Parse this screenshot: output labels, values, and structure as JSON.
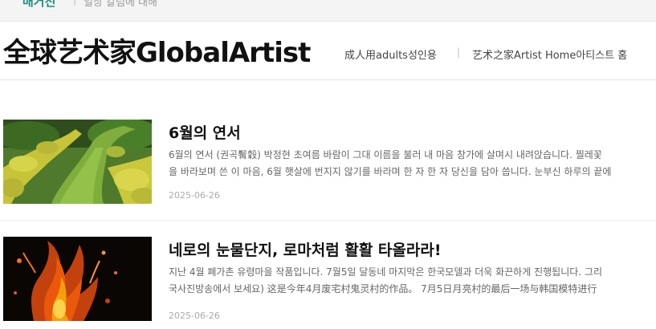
{
  "breadcrumb": {
    "section": "매거진",
    "separator": "|",
    "category": "일상 칼럼에 대해"
  },
  "header": {
    "site_title": "全球艺术家GlobalArtist",
    "nav": [
      {
        "label": "成人用adults성인용"
      },
      {
        "label": "艺术之家Artist Home아티스트 홈"
      }
    ],
    "nav_separator": "|"
  },
  "articles": [
    {
      "title": "6월의 연서",
      "excerpt_line1": "6월의 연서 (권곡鬌穀) 박정현 초여름 바람이 그대 이름을 불러 내 마음 창가에 살며시 내려앉습니다. 찔레꽃",
      "excerpt_line2": "을 바라보며 쓴 이 마음, 6월 햇살에 번지지 않기를 바라며 한 자 한 자 당신을 담아 씁니다. 눈부신 하루의 끝에",
      "date": "2025-06-26",
      "thumbnail_icon": "garden-path-image"
    },
    {
      "title": "네로의 눈물단지, 로마처럼 활활 타올라라!",
      "excerpt_line1": "지난 4월 폐가촌 유령마을 작품입니다. 7월5일 달동네 마지막은 한국모델과 더욱 화끈하게 진행됩니다. 그리",
      "excerpt_line2": "국사진방송에서 보세요) 这是今年4月废宅村鬼灵村的作品。 7月5日月亮村的最后一场与韩国模特进行",
      "date": "2025-06-26",
      "thumbnail_icon": "fire-figure-image"
    }
  ]
}
